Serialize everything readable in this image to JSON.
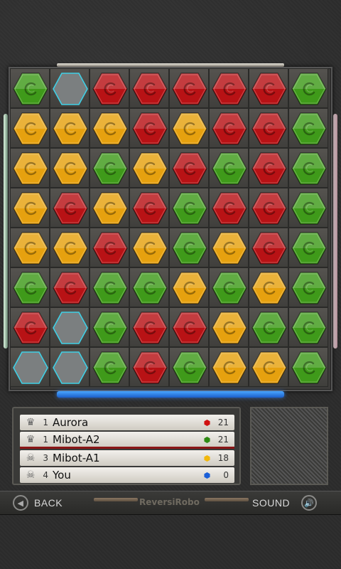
{
  "board": {
    "colors": {
      "R": "#b81215",
      "G": "#3f9a1a",
      "Y": "#e6a10f",
      "E": "#7d8285"
    },
    "grid": [
      [
        "G",
        "E",
        "R",
        "R",
        "R",
        "R",
        "R",
        "G"
      ],
      [
        "Y",
        "Y",
        "Y",
        "R",
        "Y",
        "R",
        "R",
        "G"
      ],
      [
        "Y",
        "Y",
        "G",
        "Y",
        "R",
        "G",
        "R",
        "G"
      ],
      [
        "Y",
        "R",
        "Y",
        "R",
        "G",
        "R",
        "R",
        "G"
      ],
      [
        "Y",
        "Y",
        "R",
        "Y",
        "G",
        "Y",
        "R",
        "G"
      ],
      [
        "G",
        "R",
        "G",
        "G",
        "Y",
        "G",
        "Y",
        "G"
      ],
      [
        "R",
        "E",
        "G",
        "R",
        "R",
        "Y",
        "G",
        "G"
      ],
      [
        "E",
        "E",
        "G",
        "R",
        "G",
        "Y",
        "Y",
        "G"
      ]
    ]
  },
  "players": [
    {
      "rank": "1",
      "name": "Aurora",
      "score": "21",
      "color": "#d01010",
      "icon": "crown-icon",
      "glyph": "♛"
    },
    {
      "rank": "1",
      "name": "Mibot-A2",
      "score": "21",
      "color": "#2e8a12",
      "icon": "crown-icon",
      "glyph": "♛"
    },
    {
      "rank": "3",
      "name": "Mibot-A1",
      "score": "18",
      "color": "#f2b80c",
      "icon": "skull-icon",
      "glyph": "☠"
    },
    {
      "rank": "4",
      "name": "You",
      "score": "0",
      "color": "#1a5fd8",
      "icon": "skull-icon",
      "glyph": "☠"
    }
  ],
  "bottombar": {
    "back_label": "BACK",
    "sound_label": "SOUND",
    "logo": "ReversiRobo"
  }
}
